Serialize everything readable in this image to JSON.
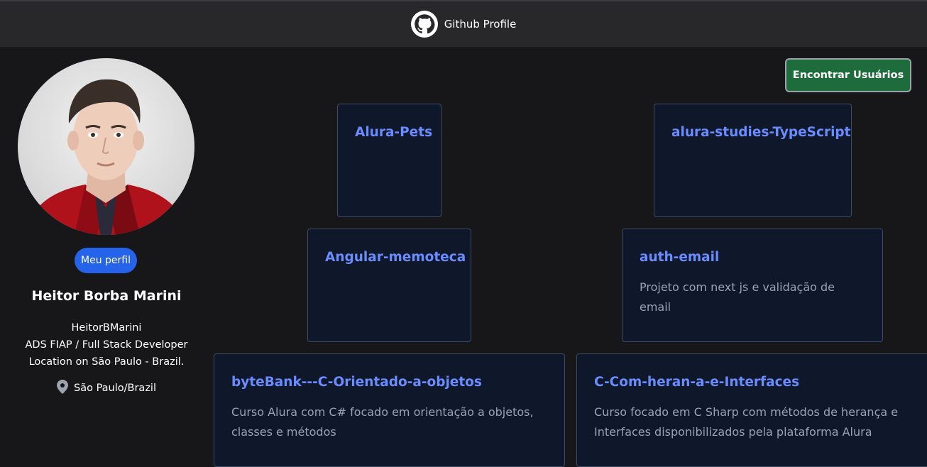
{
  "header": {
    "title": "Github Profile",
    "icon": "github-icon"
  },
  "profile": {
    "avatar": "profile-photo",
    "profile_button": "Meu perfil",
    "name": "Heitor Borba Marini",
    "username": "HeitorBMarini",
    "bio": "ADS FIAP / Full Stack Developer",
    "location_note": "Location on São Paulo - Brazil.",
    "location": "São Paulo/Brazil",
    "location_icon": "map-pin-icon"
  },
  "actions": {
    "find_users": "Encontrar Usuários"
  },
  "colors": {
    "accent_blue": "#2563eb",
    "find_button_green": "#1e6b3b",
    "repo_title": "#6b8cff",
    "card_bg": "#0f172a"
  },
  "repos": [
    {
      "name": "Alura-Pets",
      "description": ""
    },
    {
      "name": "alura-studies-TypeScript",
      "description": ""
    },
    {
      "name": "Angular-memoteca",
      "description": ""
    },
    {
      "name": "auth-email",
      "description": "Projeto com next js e validação de email"
    },
    {
      "name": "byteBank---C-Orientado-a-objetos",
      "description": "Curso Alura com C# focado em orientação a objetos, classes e métodos"
    },
    {
      "name": "C-Com-heran-a-e-Interfaces",
      "description": "Curso focado em C Sharp com métodos de herança e Interfaces disponibilizados pela plataforma Alura"
    }
  ]
}
